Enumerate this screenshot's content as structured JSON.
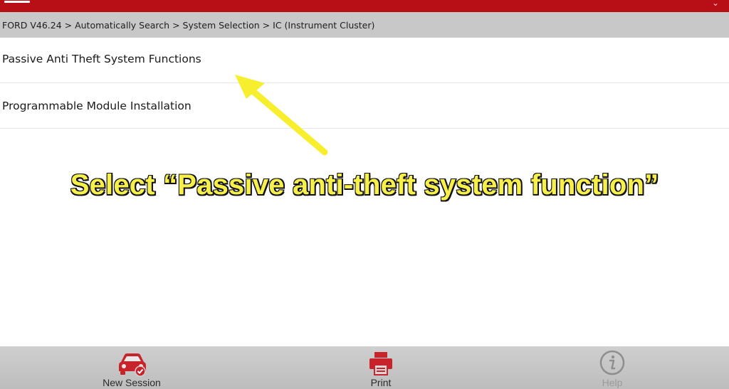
{
  "breadcrumb": {
    "text": "FORD V46.24 > Automatically Search > System Selection > IC (Instrument Cluster)"
  },
  "list": {
    "items": [
      {
        "label": "Passive Anti Theft System Functions"
      },
      {
        "label": "Programmable Module Installation"
      }
    ]
  },
  "annotation": {
    "caption": "Select “Passive anti-theft system function”",
    "color": "#f8f04a"
  },
  "toolbar": {
    "new_session_label": "New Session",
    "print_label": "Print",
    "help_label": "Help"
  },
  "colors": {
    "accent": "#b80e16",
    "breadcrumb_bg": "#c8c8c8",
    "toolbar_bg": "#c4c4c4"
  },
  "icons": {
    "menu": "hamburger-icon",
    "new_session": "car-check-icon",
    "print": "printer-icon",
    "help": "info-icon"
  }
}
